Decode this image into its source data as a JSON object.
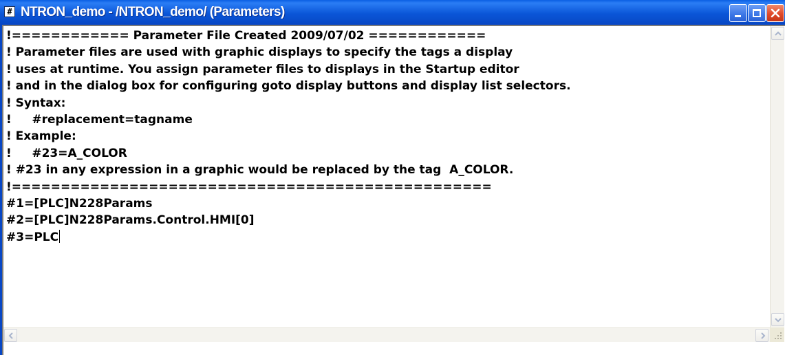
{
  "window": {
    "title": "NTRON_demo - /NTRON_demo/ (Parameters)",
    "icon_glyph": "#",
    "icon_name": "parameter-file-icon",
    "controls": [
      "minimize-icon",
      "maximize-icon",
      "close-icon"
    ]
  },
  "editor": {
    "lines": [
      "!============ Parameter File Created 2009/07/02 ============",
      "! Parameter files are used with graphic displays to specify the tags a display",
      "! uses at runtime. You assign parameter files to displays in the Startup editor",
      "! and in the dialog box for configuring goto display buttons and display list selectors.",
      "! Syntax:",
      "!     #replacement=tagname",
      "! Example:",
      "!     #23=A_COLOR",
      "! #23 in any expression in a graphic would be replaced by the tag  A_COLOR.",
      "!=================================================",
      "#1=[PLC]N228Params",
      "#2=[PLC]N228Params.Control.HMI[0]",
      "#3=PLC"
    ],
    "caret_line": 12
  },
  "colors": {
    "titlebar": "#0a56d8",
    "close_button": "#e0492a",
    "text": "#000000",
    "background": "#ffffff"
  }
}
